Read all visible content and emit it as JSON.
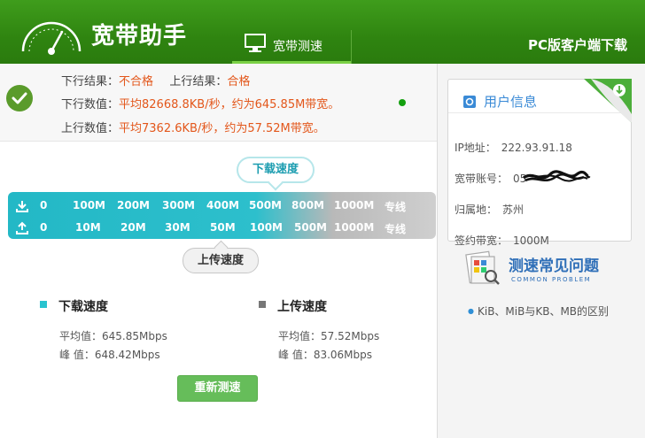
{
  "header": {
    "title": "宽带助手",
    "nav_tab": "宽带测速",
    "pc_link": "PC版客户端下载"
  },
  "results": {
    "down_result_label": "下行结果：",
    "down_result_value": "不合格",
    "up_result_label": "上行结果：",
    "up_result_value": "合格",
    "down_value_label": "下行数值：",
    "down_value_text": "平均82668.8KB/秒，约为645.85M带宽。",
    "up_value_label": "上行数值：",
    "up_value_text": "平均7362.6KB/秒，约为57.52M带宽。"
  },
  "scale": {
    "download_bubble": "下载速度",
    "upload_bubble": "上传速度",
    "download_ticks": [
      "0",
      "100M",
      "200M",
      "300M",
      "400M",
      "500M",
      "800M",
      "1000M",
      "专线"
    ],
    "upload_ticks": [
      "0",
      "10M",
      "20M",
      "30M",
      "50M",
      "100M",
      "500M",
      "1000M",
      "专线"
    ]
  },
  "stats": {
    "download": {
      "title": "下载速度",
      "avg_label": "平均值：",
      "avg_value": "645.85Mbps",
      "peak_label": "峰 值：",
      "peak_value": "648.42Mbps",
      "color": "#29c3cf"
    },
    "upload": {
      "title": "上传速度",
      "avg_label": "平均值：",
      "avg_value": "57.52Mbps",
      "peak_label": "峰 值：",
      "peak_value": "83.06Mbps",
      "color": "#777777"
    },
    "retest_label": "重新测速"
  },
  "user_info": {
    "title": "用户信息",
    "ip_label": "IP地址：",
    "ip_value": "222.93.91.18",
    "account_label": "宽带账号：",
    "account_value": "05",
    "location_label": "归属地：",
    "location_value": "苏州",
    "bandwidth_label": "签约带宽：",
    "bandwidth_value": "1000M"
  },
  "faq": {
    "title": "测速常见问题",
    "subtitle": "COMMON PROBLEM",
    "link": "KiB、MiB与KB、MB的区别"
  },
  "colors": {
    "header_green": "#2f8410",
    "fail": "#e3571b",
    "accent_blue": "#2f6fb8",
    "scale_teal": "#23b8c6"
  }
}
